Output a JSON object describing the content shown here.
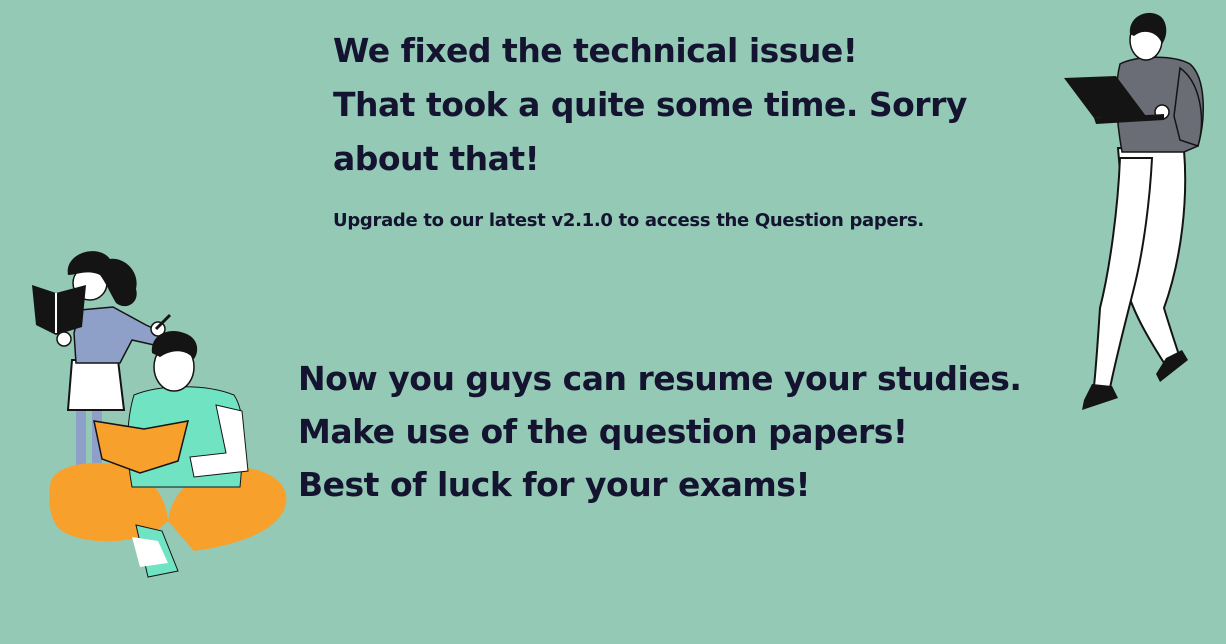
{
  "headline": {
    "line1": "We fixed the technical issue!",
    "line2": "That took a quite some time. Sorry",
    "line3": "about that!"
  },
  "subline": "Upgrade to our latest v2.1.0 to access the Question papers.",
  "message": {
    "line1": "Now you guys can resume your studies.",
    "line2": "Make use of the question papers!",
    "line3": "Best of luck for your exams!"
  },
  "colors": {
    "background": "#94c9b6",
    "text": "#141430",
    "accent_orange": "#f7a02b",
    "accent_mint": "#6fe3c2"
  },
  "icons": {
    "left": "students-studying-illustration",
    "right": "man-with-laptop-illustration"
  }
}
